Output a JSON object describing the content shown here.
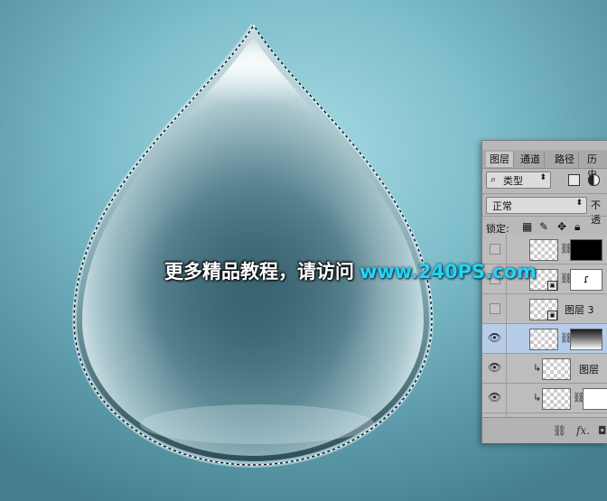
{
  "colors": {
    "background_center": "#a6dbe4",
    "background_edge": "#457f8f",
    "drop_dark": "#3d6673",
    "drop_light": "#e6f3f6",
    "panel_bg": "#b9b9b9",
    "selected_layer": "#b6cdea",
    "watermark_url": "#27d4f2"
  },
  "canvas": {
    "object": "water-drop",
    "selection": "marching-ants-outline"
  },
  "layers_panel": {
    "tabs": [
      "图层",
      "通道",
      "路径",
      "历史"
    ],
    "active_tab": "图层",
    "filter": {
      "icon": "search-icon",
      "label": "类型"
    },
    "blend_mode": "正常",
    "opacity_label": "不透",
    "lock_label": "锁定:",
    "lock_icons": [
      "lock-transparent-icon",
      "lock-paint-icon",
      "lock-move-icon",
      "lock-all-icon"
    ],
    "layers": [
      {
        "name": "",
        "visible": false,
        "has_mask": true,
        "selected": false
      },
      {
        "name": "",
        "visible": false,
        "has_mask": true,
        "selected": false
      },
      {
        "name": "图层 3",
        "visible": false,
        "has_mask": false,
        "selected": false
      },
      {
        "name": "",
        "visible": true,
        "has_mask": true,
        "selected": true
      },
      {
        "name": "图层",
        "visible": true,
        "has_mask": false,
        "clipped": true,
        "selected": false
      },
      {
        "name": "",
        "visible": true,
        "has_mask": true,
        "clipped": true,
        "selected": false
      },
      {
        "name": "",
        "visible": false,
        "has_mask": false,
        "selected": false
      }
    ],
    "footer": {
      "link_icon": "link-icon",
      "fx_label": "fx.",
      "mask_icon": "add-mask-icon"
    }
  },
  "watermark": {
    "text_cn": "更多精品教程，请访问",
    "text_url": "www.240PS.com"
  }
}
